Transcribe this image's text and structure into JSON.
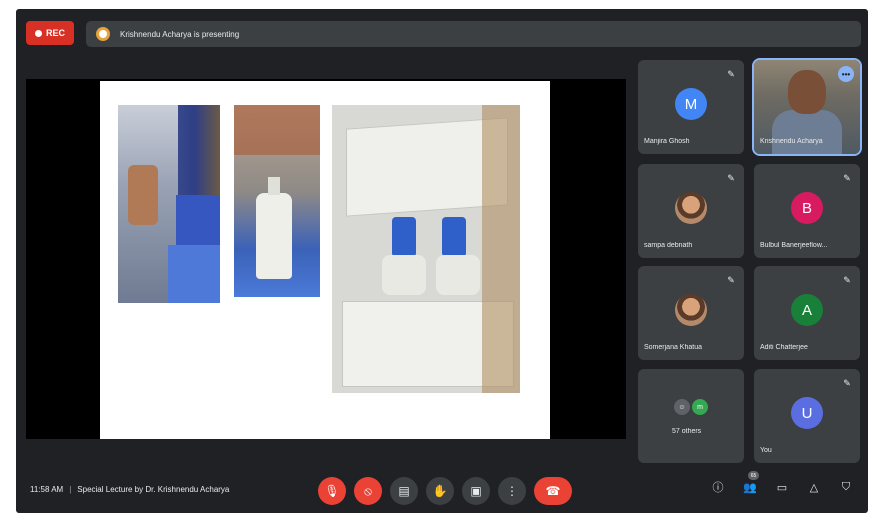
{
  "top": {
    "rec_label": "REC",
    "presenting_text": "Krishnendu Acharya is presenting"
  },
  "colors": {
    "background": "#202124",
    "tile": "#3c4043",
    "danger": "#ea4335",
    "accent": "#8ab4f8"
  },
  "tiles": [
    {
      "name": "Manjira Ghosh",
      "initial": "M",
      "color": "#4285f4",
      "type": "letter"
    },
    {
      "name": "Krishnendu Acharya",
      "type": "camera",
      "more": "•••"
    },
    {
      "name": "sampa debnath",
      "type": "photo"
    },
    {
      "name": "Bulbul Banerjeeflow...",
      "initial": "B",
      "color": "#d81b60",
      "type": "letter"
    },
    {
      "name": "Somerjana Khatua",
      "type": "photo"
    },
    {
      "name": "Aditi Chatterjee",
      "initial": "A",
      "color": "#188038",
      "type": "letter"
    },
    {
      "name": "57 others",
      "mini_initial": "m",
      "type": "others"
    },
    {
      "name": "You",
      "initial": "U",
      "color": "#5b6ee1",
      "type": "letter"
    }
  ],
  "bottom": {
    "time": "11:58 AM",
    "separator": "|",
    "meeting_title": "Special Lecture by Dr. Krishnendu Acharya",
    "participant_count": "65"
  },
  "icons": {
    "mic_off": "mic-off-icon",
    "camera_off": "camera-off-icon",
    "captions": "captions-icon",
    "hand": "raise-hand-icon",
    "present": "present-icon",
    "more": "more-options-icon",
    "end_call": "end-call-icon",
    "info": "info-icon",
    "people": "people-icon",
    "chat": "chat-icon",
    "activities": "activities-icon",
    "host": "host-controls-icon"
  }
}
